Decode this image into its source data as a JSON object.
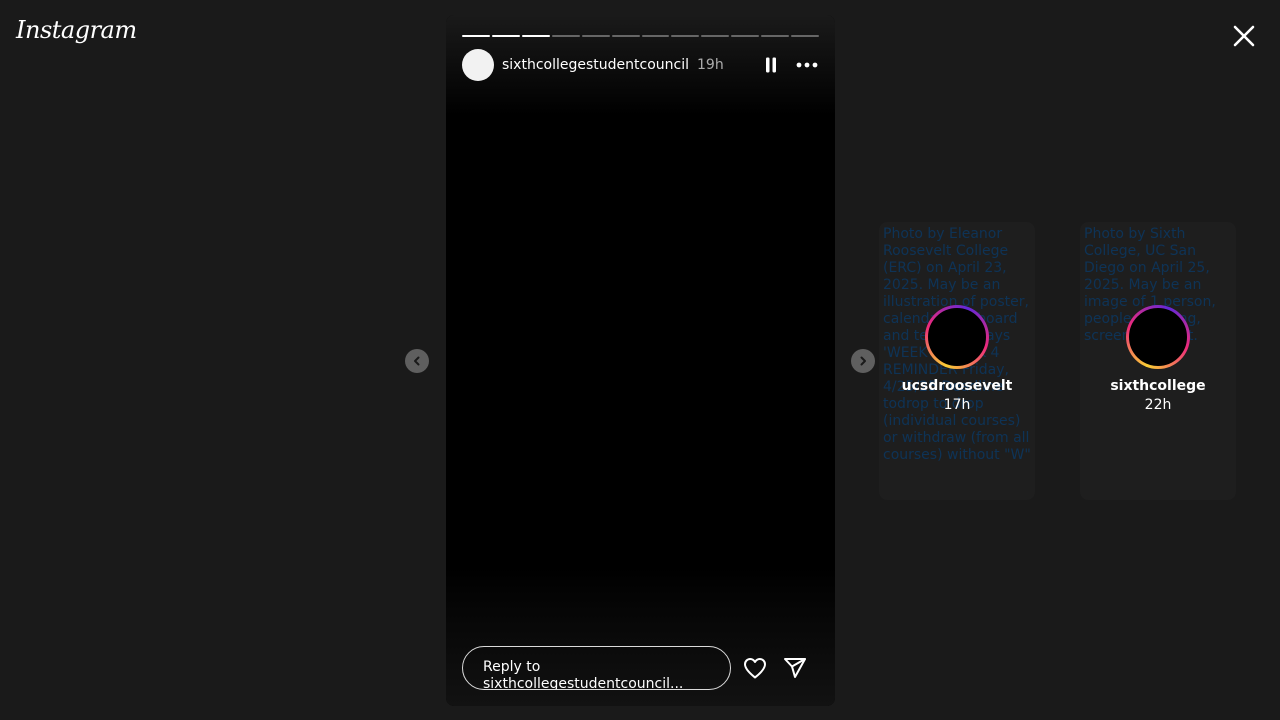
{
  "app": {
    "logo_text": "Instagram",
    "accent_gradient": [
      "#f9ce34",
      "#ee2a7b",
      "#6228d7"
    ],
    "background": "#1a1a1a"
  },
  "close_icon": "close-icon",
  "story": {
    "username": "sixthcollegestudentcouncil",
    "time": "19h",
    "segments_total": 12,
    "segments_completed": 3,
    "controls": {
      "pause_icon": "pause-icon",
      "more_icon": "more-horizontal-icon"
    },
    "reply": {
      "placeholder": "Reply to sixthcollegestudentcouncil...",
      "like_icon": "heart-icon",
      "share_icon": "send-icon"
    }
  },
  "nav": {
    "prev_icon": "chevron-left-icon",
    "next_icon": "chevron-right-icon"
  },
  "previews": [
    {
      "username": "ucsdroosevelt",
      "time": "17h",
      "alt": "Photo by Eleanor Roosevelt College (ERC) on April 23, 2025. May be an illustration of poster, calendar, clipboard and text that says 'WEEK 4 WEEK 4 REMINDER Friday, 4/25/25 Deadline todrop to drop (individual courses) or withdraw (from all courses) without \"W\""
    },
    {
      "username": "sixthcollege",
      "time": "22h",
      "alt": "Photo by Sixth College, UC San Diego on April 25, 2025. May be an image of 1 person, people studying, screen and text."
    }
  ]
}
